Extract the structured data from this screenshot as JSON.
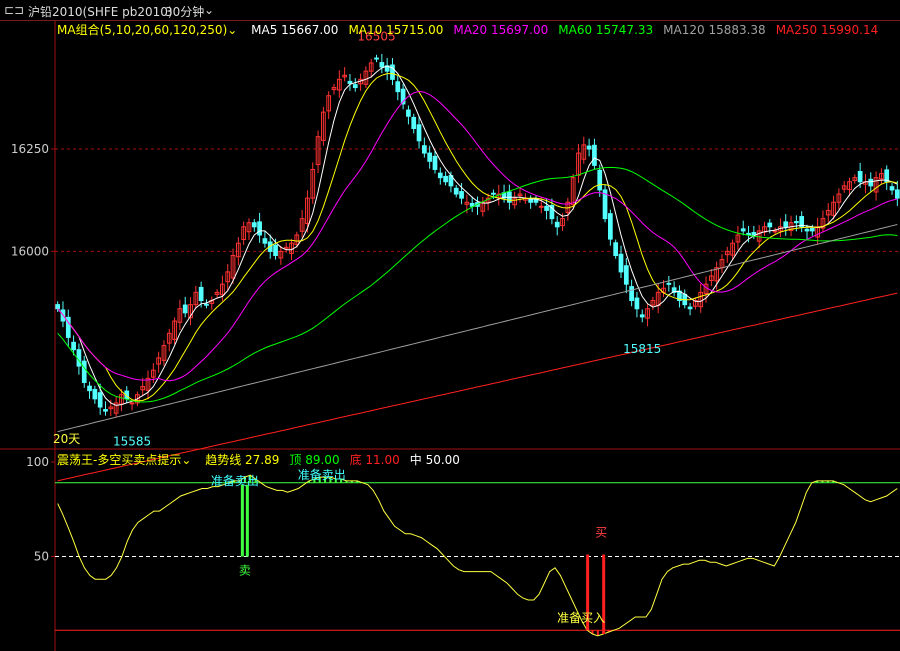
{
  "window": {
    "instrument": "沪铅2010(SHFE pb2010)",
    "period": "30分钟",
    "icon": "link-icon",
    "chevron": "chevron-down-icon"
  },
  "colors": {
    "background": "#000000",
    "up": "#ff3232",
    "down": "#54ffff",
    "grid": "#a01010",
    "ma5": "#ffffff",
    "ma10": "#ffff00",
    "ma20": "#ff00ff",
    "ma60": "#00ff00",
    "ma120": "#a0a0a0",
    "ma250": "#ff2020",
    "oscillator": "#ffff40",
    "sell_bar": "#40ff40",
    "buy_bar": "#ff2020"
  },
  "legend_main": {
    "label": "MA组合(5,10,20,60,120,250)",
    "items": [
      {
        "name": "MA5",
        "value": "15667.00",
        "color": "#ffffff"
      },
      {
        "name": "MA10",
        "value": "15715.00",
        "color": "#ffff00"
      },
      {
        "name": "MA20",
        "value": "15697.00",
        "color": "#ff00ff"
      },
      {
        "name": "MA60",
        "value": "15747.33",
        "color": "#00ff00"
      },
      {
        "name": "MA120",
        "value": "15883.38",
        "color": "#a0a0a0"
      },
      {
        "name": "MA250",
        "value": "15990.14",
        "color": "#ff2020"
      }
    ]
  },
  "legend_osc": {
    "label": "震荡王-多空买卖点提示",
    "items": [
      {
        "name": "趋势线",
        "value": "27.89",
        "color": "#ffff00"
      },
      {
        "name": "顶",
        "value": "89.00",
        "color": "#00ff00"
      },
      {
        "name": "底",
        "value": "11.00",
        "color": "#ff2020"
      },
      {
        "name": "中",
        "value": "50.00",
        "color": "#ffffff"
      }
    ]
  },
  "annotations": {
    "period_label": "20天",
    "high_label": "16505",
    "low1_label": "15585",
    "low2_label": "15815",
    "sell_prepare_1": "准备卖出",
    "sell_prepare_2": "准备卖出",
    "sell_signal": "卖",
    "buy_prepare": "准备买入",
    "buy_signal": "买"
  },
  "chart_data": [
    {
      "type": "candlestick",
      "yticks": [
        16000,
        16250
      ],
      "ylim": [
        15520,
        16560
      ],
      "high": {
        "value": 16505,
        "index": 60
      },
      "lows": [
        {
          "value": 15585,
          "index": 14
        },
        {
          "value": 15815,
          "index": 110
        }
      ],
      "closes": [
        15860,
        15830,
        15790,
        15760,
        15720,
        15680,
        15660,
        15640,
        15620,
        15610,
        15620,
        15630,
        15650,
        15640,
        15630,
        15650,
        15670,
        15690,
        15710,
        15740,
        15770,
        15800,
        15830,
        15860,
        15850,
        15870,
        15900,
        15880,
        15870,
        15880,
        15900,
        15920,
        15950,
        15990,
        16020,
        16060,
        16070,
        16060,
        16040,
        16020,
        16000,
        15990,
        16000,
        16010,
        16020,
        16040,
        16080,
        16130,
        16200,
        16280,
        16340,
        16380,
        16400,
        16420,
        16430,
        16410,
        16400,
        16420,
        16440,
        16460,
        16470,
        16450,
        16440,
        16420,
        16390,
        16360,
        16330,
        16300,
        16270,
        16240,
        16220,
        16200,
        16180,
        16170,
        16160,
        16140,
        16130,
        16120,
        16110,
        16110,
        16120,
        16130,
        16140,
        16140,
        16130,
        16120,
        16130,
        16140,
        16130,
        16120,
        16120,
        16110,
        16100,
        16080,
        16060,
        16080,
        16120,
        16180,
        16240,
        16260,
        16250,
        16210,
        16150,
        16080,
        16030,
        15990,
        15950,
        15920,
        15880,
        15860,
        15840,
        15860,
        15880,
        15900,
        15910,
        15920,
        15900,
        15880,
        15870,
        15860,
        15880,
        15900,
        15920,
        15940,
        15960,
        15980,
        16000,
        16020,
        16040,
        16050,
        16040,
        16040,
        16050,
        16060,
        16060,
        16050,
        16060,
        16060,
        16070,
        16070,
        16060,
        16050,
        16050,
        16060,
        16080,
        16100,
        16120,
        16140,
        16160,
        16170,
        16180,
        16170,
        16170,
        16160,
        16180,
        16190,
        16170,
        16150,
        16130
      ]
    },
    {
      "type": "line",
      "ylim": [
        0,
        100
      ],
      "yticks": [
        50,
        100
      ],
      "reference_lines": {
        "top": 89,
        "bottom": 11,
        "middle": 50
      },
      "values": [
        78,
        72,
        65,
        58,
        50,
        44,
        40,
        38,
        38,
        38,
        40,
        44,
        50,
        58,
        64,
        68,
        70,
        72,
        74,
        74,
        76,
        78,
        80,
        82,
        83,
        84,
        85,
        86,
        86,
        87,
        87,
        88,
        89,
        90,
        90,
        92,
        93,
        91,
        89,
        87,
        86,
        85,
        85,
        84,
        85,
        86,
        88,
        90,
        91,
        92,
        92,
        92,
        91,
        91,
        90,
        90,
        90,
        89,
        88,
        85,
        80,
        74,
        70,
        66,
        64,
        62,
        62,
        61,
        60,
        58,
        56,
        54,
        51,
        48,
        45,
        43,
        42,
        42,
        42,
        42,
        42,
        42,
        40,
        38,
        36,
        33,
        30,
        28,
        27,
        27,
        30,
        36,
        42,
        44,
        40,
        34,
        28,
        22,
        16,
        11,
        9,
        8,
        9,
        10,
        11,
        12,
        14,
        16,
        18,
        18,
        18,
        22,
        30,
        38,
        42,
        44,
        45,
        46,
        46,
        47,
        48,
        48,
        47,
        47,
        46,
        45,
        46,
        47,
        48,
        49,
        49,
        48,
        47,
        46,
        45,
        50,
        56,
        62,
        68,
        76,
        84,
        89,
        90,
        90,
        90,
        90,
        89,
        88,
        86,
        84,
        82,
        80,
        79,
        80,
        81,
        82,
        84,
        86
      ],
      "sell_signals": [
        {
          "index": 35,
          "value": 89
        },
        {
          "index": 52,
          "value": 92
        }
      ],
      "buy_signals": [
        {
          "index": 99,
          "value": 11
        },
        {
          "index": 102,
          "value": 9
        }
      ]
    }
  ]
}
